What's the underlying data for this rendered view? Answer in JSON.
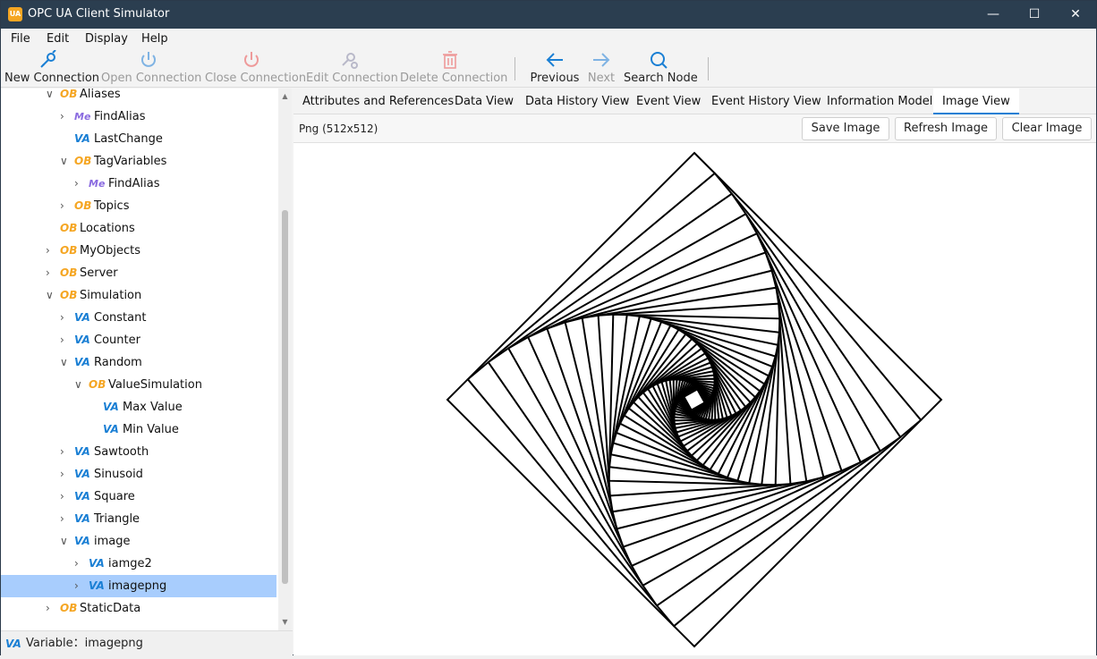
{
  "window": {
    "title": "OPC UA Client Simulator",
    "app_icon_text": "UA",
    "minimize": "—",
    "maximize": "☐",
    "close": "✕"
  },
  "menu": [
    "File",
    "Edit",
    "Display",
    "Help"
  ],
  "toolbar": {
    "new_connection": "New Connection",
    "open_connection": "Open Connection",
    "close_connection": "Close Connection",
    "edit_connection": "Edit Connection",
    "delete_connection": "Delete Connection",
    "previous": "Previous",
    "next": "Next",
    "search_node": "Search Node"
  },
  "tree": [
    {
      "label": "Aliases",
      "type": "OB",
      "level": 0,
      "state": "expanded"
    },
    {
      "label": "FindAlias",
      "type": "Me",
      "level": 1,
      "state": "collapsed"
    },
    {
      "label": "LastChange",
      "type": "VA",
      "level": 1,
      "state": "none"
    },
    {
      "label": "TagVariables",
      "type": "OB",
      "level": 1,
      "state": "expanded"
    },
    {
      "label": "FindAlias",
      "type": "Me",
      "level": 2,
      "state": "collapsed"
    },
    {
      "label": "Topics",
      "type": "OB",
      "level": 1,
      "state": "collapsed"
    },
    {
      "label": "Locations",
      "type": "OB",
      "level": 0,
      "state": "none"
    },
    {
      "label": "MyObjects",
      "type": "OB",
      "level": 0,
      "state": "collapsed"
    },
    {
      "label": "Server",
      "type": "OB",
      "level": 0,
      "state": "collapsed"
    },
    {
      "label": "Simulation",
      "type": "OB",
      "level": 0,
      "state": "expanded"
    },
    {
      "label": "Constant",
      "type": "VA",
      "level": 1,
      "state": "collapsed"
    },
    {
      "label": "Counter",
      "type": "VA",
      "level": 1,
      "state": "collapsed"
    },
    {
      "label": "Random",
      "type": "VA",
      "level": 1,
      "state": "expanded"
    },
    {
      "label": "ValueSimulation",
      "type": "OB",
      "level": 2,
      "state": "expanded"
    },
    {
      "label": "Max Value",
      "type": "VA",
      "level": 3,
      "state": "none"
    },
    {
      "label": "Min Value",
      "type": "VA",
      "level": 3,
      "state": "none"
    },
    {
      "label": "Sawtooth",
      "type": "VA",
      "level": 1,
      "state": "collapsed"
    },
    {
      "label": "Sinusoid",
      "type": "VA",
      "level": 1,
      "state": "collapsed"
    },
    {
      "label": "Square",
      "type": "VA",
      "level": 1,
      "state": "collapsed"
    },
    {
      "label": "Triangle",
      "type": "VA",
      "level": 1,
      "state": "collapsed"
    },
    {
      "label": "image",
      "type": "VA",
      "level": 1,
      "state": "expanded"
    },
    {
      "label": "iamge2",
      "type": "VA",
      "level": 2,
      "state": "collapsed"
    },
    {
      "label": "imagepng",
      "type": "VA",
      "level": 2,
      "state": "collapsed",
      "selected": true
    },
    {
      "label": "StaticData",
      "type": "OB",
      "level": 0,
      "state": "collapsed"
    }
  ],
  "status": {
    "badge": "VA",
    "text": "Variable：imagepng"
  },
  "tabs": [
    "Attributes and References",
    "Data View",
    "Data History View",
    "Event View",
    "Event History View",
    "Information Model",
    "Image View"
  ],
  "image_view": {
    "info": "Png (512x512)",
    "save": "Save Image",
    "refresh": "Refresh Image",
    "clear": "Clear Image"
  },
  "colors": {
    "titlebar": "#2b3e50",
    "selection": "#a8cdfd",
    "accent": "#1a7fd4",
    "ob": "#f5a623",
    "va": "#1a7fd4",
    "me": "#8a6be0"
  }
}
